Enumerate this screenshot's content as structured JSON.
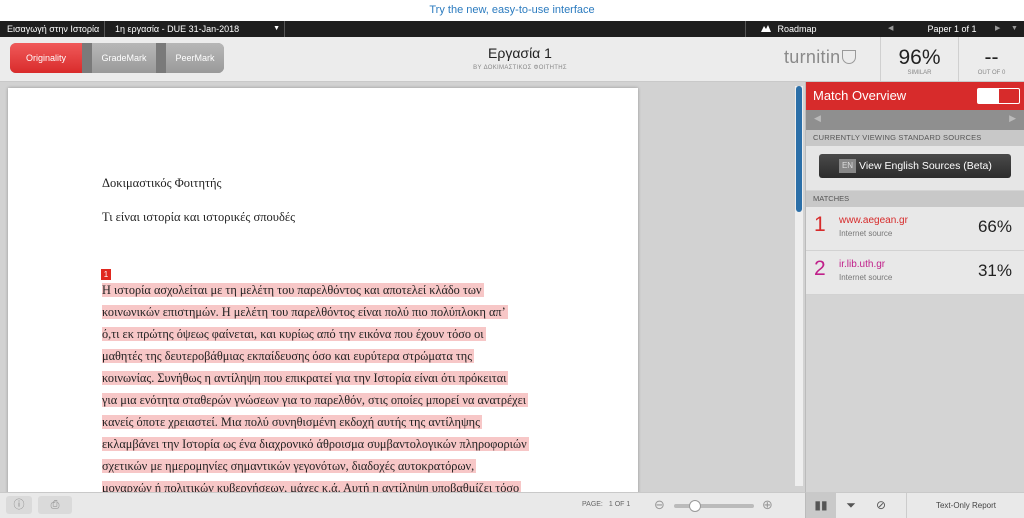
{
  "banner": {
    "text": "Try the new, easy-to-use interface"
  },
  "topbar": {
    "class_name": "Εισαγωγή στην Ιστορία",
    "assignment": "1η εργασία - DUE 31-Jan-2018",
    "roadmap": "Roadmap",
    "pager": "Paper 1 of 1"
  },
  "modes": {
    "originality": "Originality",
    "grademark": "GradeMark",
    "peermark": "PeerMark"
  },
  "document": {
    "title": "Εργασία 1",
    "byline": "BY ΔΟΚΙΜΑΣΤΙΚΟΣ ΦΟΙΤΗΤΗΣ"
  },
  "logo": {
    "text": "turnitin"
  },
  "similarity": {
    "value": "96%",
    "label": "SIMILAR"
  },
  "out_of": {
    "value": "--",
    "label": "OUT OF 0"
  },
  "paper": {
    "author": "Δοκιμαστικός Φοιτητής",
    "subtitle": "Τι είναι ιστορία και ιστορικές σπουδές",
    "match_number": "1",
    "lines": [
      "Η ιστορία ασχολείται με τη μελέτη του παρελθόντος και αποτελεί κλάδο των",
      "κοινωνικών επιστημών.  Η μελέτη του παρελθόντος είναι πολύ πιο πολύπλοκη απ’",
      "ό,τι εκ πρώτης όψεως φαίνεται, και κυρίως από την εικόνα που έχουν τόσο οι",
      "μαθητές της δευτεροβάθμιας εκπαίδευσης όσο και ευρύτερα στρώματα της",
      "κοινωνίας.  Συνήθως η αντίληψη που επικρατεί για την Ιστορία είναι ότι πρόκειται",
      "για μια ενότητα σταθερών γνώσεων για το παρελθόν, στις οποίες μπορεί να ανατρέχει",
      "κανείς όποτε χρειαστεί.  Μια πολύ συνηθισμένη εκδοχή αυτής της αντίληψης",
      "εκλαμβάνει την Ιστορία ως ένα διαχρονικό άθροισμα συμβαντολογικών πληροφοριών",
      "σχετικών με ημερομηνίες σημαντικών γεγονότων, διαδοχές αυτοκρατόρων,",
      "μοναρχών ή πολιτικών κυβερνήσεων, μάχες κ.ά.  Αυτή η αντίληψη υποβαθμίζει τόσο"
    ]
  },
  "footer": {
    "page_label": "PAGE:",
    "page_value": "1 OF 1",
    "zoom_level": 0.26
  },
  "sidebar": {
    "title": "Match Overview",
    "current_label": "CURRENTLY VIEWING STANDARD SOURCES",
    "view_sources_badge": "EN",
    "view_sources": "View English Sources (Beta)",
    "matches_label": "MATCHES",
    "matches": [
      {
        "number": "1",
        "source": "www.aegean.gr",
        "type": "Internet source",
        "percent": "66%",
        "color": "#d72b2b"
      },
      {
        "number": "2",
        "source": "ir.lib.uth.gr",
        "type": "Internet source",
        "percent": "31%",
        "color": "#c0208a"
      }
    ],
    "text_only": "Text-Only Report"
  }
}
